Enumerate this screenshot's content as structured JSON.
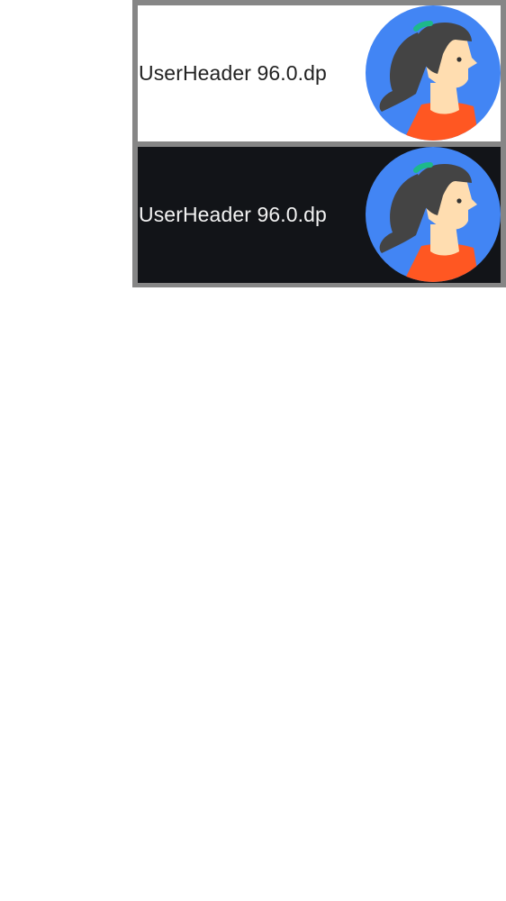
{
  "headers": [
    {
      "theme": "light",
      "label": "UserHeader 96.0.dp"
    },
    {
      "theme": "dark",
      "label": "UserHeader 96.0.dp"
    }
  ],
  "avatar": {
    "icon": "user-avatar-woman-icon",
    "colors": {
      "background": "#4285F4",
      "hair": "#444444",
      "skin": "#FFDDB0",
      "shirt": "#FF5722",
      "hair_clip": "#1DB98A"
    }
  },
  "frame": {
    "border_color": "#868686",
    "dark_bg": "#121418"
  }
}
